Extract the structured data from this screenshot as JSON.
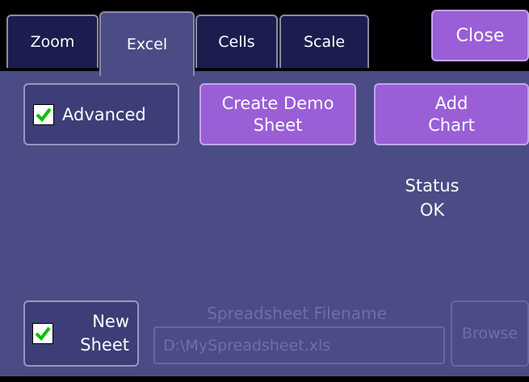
{
  "tabs": [
    {
      "label": "Zoom",
      "active": false
    },
    {
      "label": "Excel",
      "active": true
    },
    {
      "label": "Cells",
      "active": false
    },
    {
      "label": "Scale",
      "active": false
    }
  ],
  "close_label": "Close",
  "advanced": {
    "label": "Advanced",
    "checked": true
  },
  "create_demo": {
    "line1": "Create Demo",
    "line2": "Sheet"
  },
  "add_chart": {
    "line1": "Add",
    "line2": "Chart"
  },
  "status": {
    "label": "Status",
    "value": "OK"
  },
  "new_sheet": {
    "line1": "New",
    "line2": "Sheet",
    "checked": true
  },
  "filename": {
    "label": "Spreadsheet Filename",
    "value": "D:\\MySpreadsheet.xls"
  },
  "browse_label": "Browse",
  "colors": {
    "panel": "#4b4b85",
    "button": "#9a5ed6",
    "tab_inactive": "#1b1d4e",
    "check": "#00c000"
  }
}
